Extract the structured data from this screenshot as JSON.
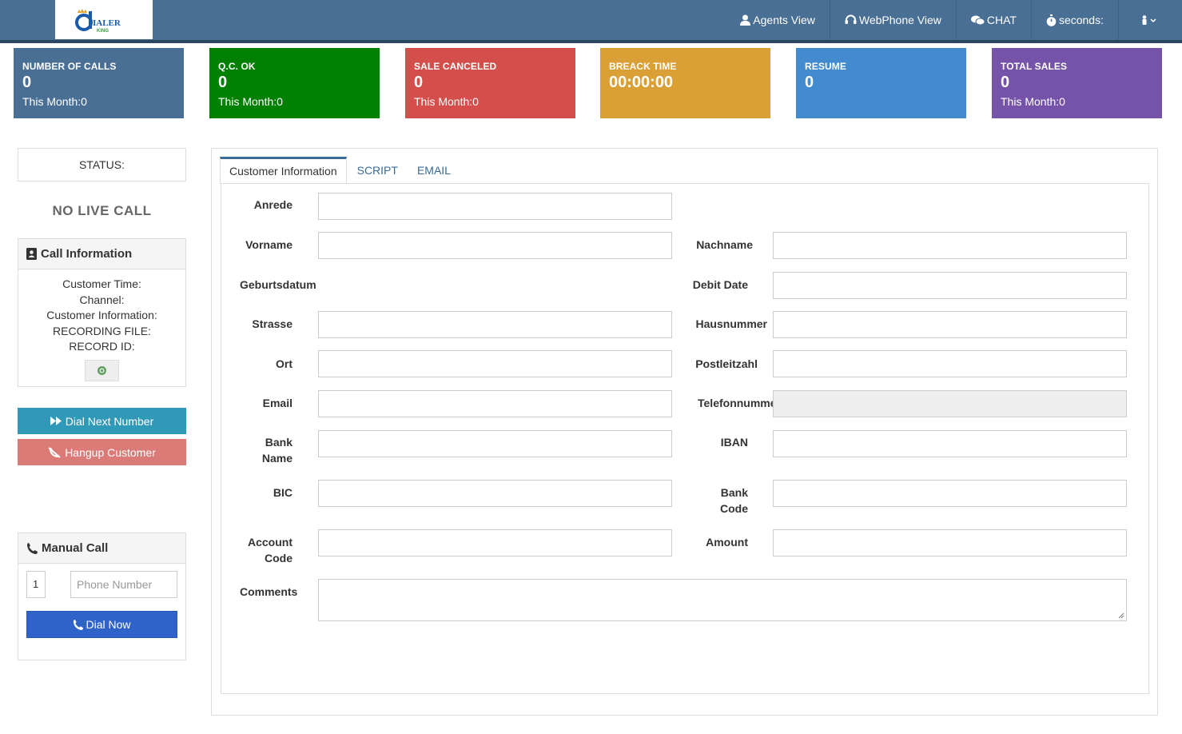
{
  "navbar": {
    "logo_alt": "Dialer King",
    "items": [
      {
        "label": "Agents View",
        "icon": "user-icon"
      },
      {
        "label": "WebPhone View",
        "icon": "headset-icon"
      },
      {
        "label": "CHAT",
        "icon": "chat-icon"
      },
      {
        "label": "seconds:",
        "icon": "stopwatch-icon"
      }
    ],
    "user_menu_icon": "user-menu-icon"
  },
  "stats": [
    {
      "title": "NUMBER OF CALLS",
      "value": "0",
      "sub": "This Month:0",
      "color": "#4a6f95"
    },
    {
      "title": "Q.C. OK",
      "value": "0",
      "sub": "This Month:0",
      "color": "#008000"
    },
    {
      "title": "SALE CANCELED",
      "value": "0",
      "sub": "This Month:0",
      "color": "#d44f4b"
    },
    {
      "title": "BREACK TIME",
      "value": "00:00:00",
      "sub": "",
      "color": "#dba035"
    },
    {
      "title": "RESUME",
      "value": "0",
      "sub": "",
      "color": "#428bce"
    },
    {
      "title": "TOTAL SALES",
      "value": "0",
      "sub": "This Month:0",
      "color": "#7553a9"
    }
  ],
  "left": {
    "status_label": "STATUS:",
    "no_live_call": "NO LIVE CALL",
    "call_info": {
      "title": "Call Information",
      "lines": [
        "Customer Time:",
        "Channel:",
        "Customer Information:",
        "RECORDING FILE:",
        "RECORD ID:"
      ]
    },
    "dial_next": "Dial Next Number",
    "hangup": "Hangup Customer",
    "manual_call": {
      "title": "Manual Call",
      "code_value": "1",
      "phone_placeholder": "Phone Number",
      "dial_now": "Dial Now"
    }
  },
  "tabs": [
    "Customer Information",
    "SCRIPT",
    "EMAIL"
  ],
  "form": {
    "anrede": "Anrede",
    "vorname": "Vorname",
    "nachname": "Nachname",
    "geburtsdatum": "Geburtsdatum",
    "debit_date": "Debit Date",
    "strasse": "Strasse",
    "hausnummer": "Hausnummer",
    "ort": "Ort",
    "postleitzahl": "Postleitzahl",
    "email": "Email",
    "telefonnummer": "Telefonnumme",
    "bank_name_1": "Bank",
    "bank_name_2": "Name",
    "iban": "IBAN",
    "bic": "BIC",
    "bank_code_1": "Bank",
    "bank_code_2": "Code",
    "account_code_1": "Account",
    "account_code_2": "Code",
    "amount": "Amount",
    "comments": "Comments"
  }
}
